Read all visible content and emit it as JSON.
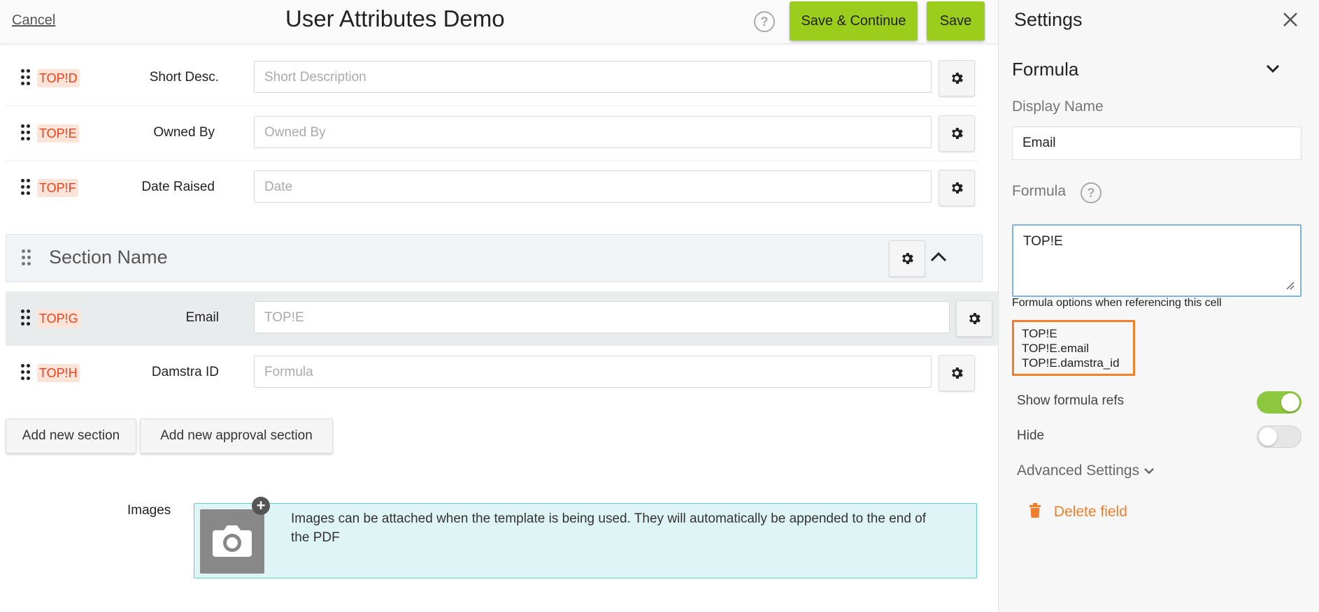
{
  "header": {
    "cancel_label": "Cancel",
    "title": "User Attributes Demo",
    "save_continue_label": "Save & Continue",
    "save_label": "Save",
    "help_glyph": "?"
  },
  "rows": [
    {
      "tag": "TOP!D",
      "label": "Short Desc.",
      "placeholder": "Short Description"
    },
    {
      "tag": "TOP!E",
      "label": "Owned By",
      "placeholder": "Owned By"
    },
    {
      "tag": "TOP!F",
      "label": "Date Raised",
      "placeholder": "Date"
    }
  ],
  "section": {
    "title": "Section Name"
  },
  "section_rows": [
    {
      "tag": "TOP!G",
      "label": "Email",
      "placeholder": "TOP!E"
    },
    {
      "tag": "TOP!H",
      "label": "Damstra ID",
      "placeholder": "Formula"
    }
  ],
  "actions": {
    "add_section": "Add new section",
    "add_approval_section": "Add new approval section"
  },
  "images": {
    "label": "Images",
    "text": "Images can be attached when the template is being used. They will automatically be appended to the end of the PDF",
    "plus_glyph": "+"
  },
  "settings": {
    "title": "Settings",
    "group_title": "Formula",
    "display_name_label": "Display Name",
    "display_name_value": "Email",
    "formula_label": "Formula",
    "formula_value": "TOP!E",
    "options_caption": "Formula options when referencing this cell",
    "options": [
      "TOP!E",
      "TOP!E.email",
      "TOP!E.damstra_id"
    ],
    "show_refs_label": "Show formula refs",
    "show_refs_on": true,
    "hide_label": "Hide",
    "hide_on": false,
    "advanced_label": "Advanced Settings",
    "delete_label": "Delete field"
  },
  "colors": {
    "accent_green": "#9acd1c",
    "toggle_on": "#8dc63f",
    "tag_text": "#e8421c",
    "tag_bg": "#fde3d8",
    "highlight_orange": "#f07f2c"
  }
}
